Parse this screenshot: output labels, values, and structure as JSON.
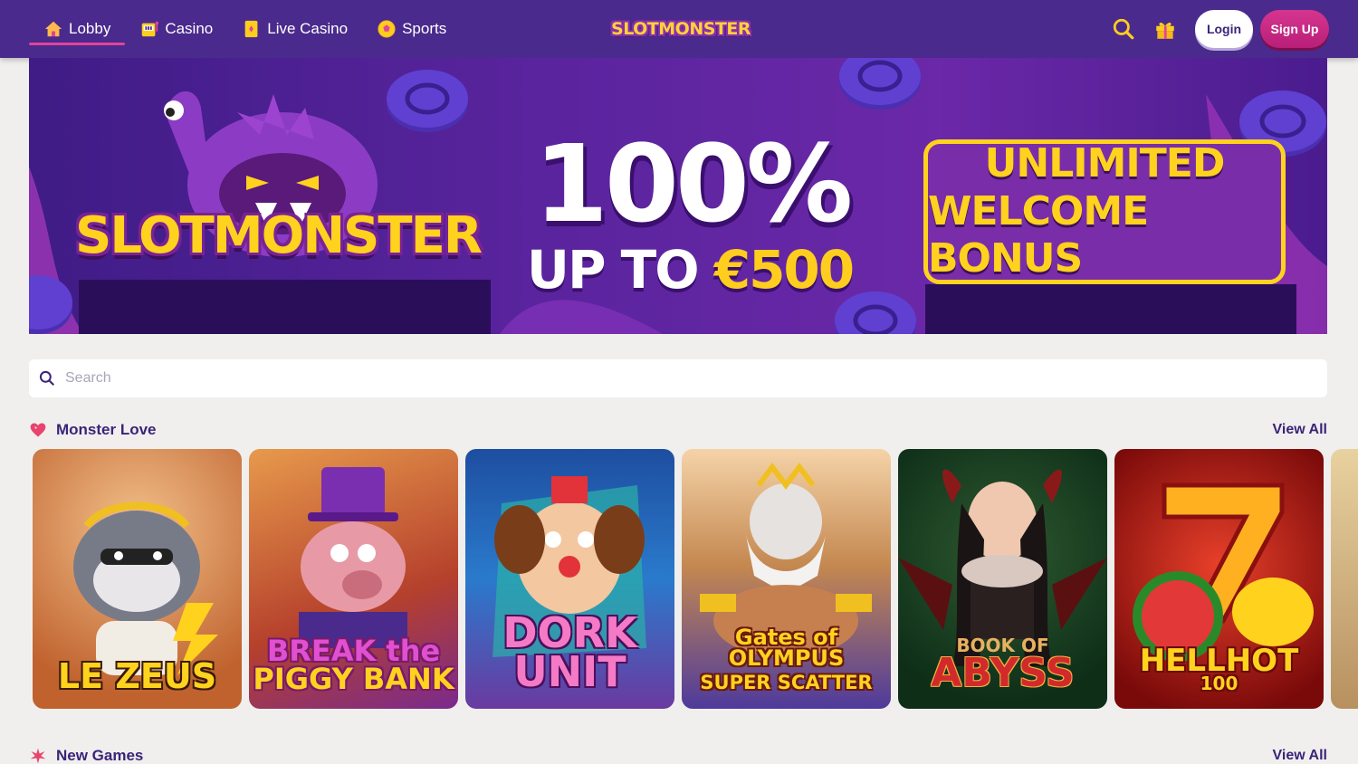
{
  "nav": {
    "items": [
      {
        "label": "Lobby",
        "icon": "home-icon",
        "active": true
      },
      {
        "label": "Casino",
        "icon": "slot-machine-icon",
        "active": false
      },
      {
        "label": "Live Casino",
        "icon": "card-icon",
        "active": false
      },
      {
        "label": "Sports",
        "icon": "soccer-ball-icon",
        "active": false
      }
    ]
  },
  "header": {
    "logo_text": "SLOTMONSTER",
    "login_label": "Login",
    "signup_label": "Sign Up"
  },
  "banner": {
    "brand": "SLOTMONSTER",
    "percent": "100%",
    "up_to": "UP TO",
    "amount": "€500",
    "box_line1": "UNLIMITED",
    "box_line2": "WELCOME BONUS"
  },
  "search": {
    "placeholder": "Search"
  },
  "sections": [
    {
      "title": "Monster Love",
      "view_all": "View All",
      "icon": "heart-icon"
    },
    {
      "title": "New Games",
      "view_all": "View All",
      "icon": "star-burst-icon"
    }
  ],
  "games": [
    {
      "name_line1": "LE ZEUS",
      "name_line2": ""
    },
    {
      "name_line1": "BREAK the",
      "name_line2": "PIGGY BANK"
    },
    {
      "name_line1": "DORK",
      "name_line2": "UNIT"
    },
    {
      "name_line1": "Gates of OLYMPUS",
      "name_line2": "SUPER SCATTER"
    },
    {
      "name_line1": "BOOK OF",
      "name_line2": "ABYSS"
    },
    {
      "name_line1": "HELLHOT",
      "name_line2": "100"
    }
  ],
  "colors": {
    "header_bg": "#4a2a8c",
    "accent_pink": "#e2439a",
    "brand_yellow": "#ffd21e",
    "text_purple": "#3b2478"
  }
}
